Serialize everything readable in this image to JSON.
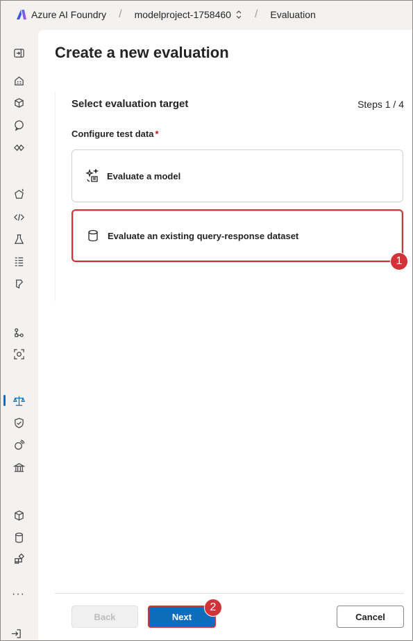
{
  "header": {
    "brand": "Azure AI Foundry",
    "project": "modelproject-1758460",
    "page": "Evaluation"
  },
  "rail": {
    "icons": [
      "expand-icon",
      "home-icon",
      "models-icon",
      "chat-icon",
      "overview-icon",
      "agents-icon",
      "code-icon",
      "playground-icon",
      "data-icon",
      "fine-tune-icon",
      "tracing-icon",
      "monitoring-icon",
      "evaluation-icon",
      "safety-icon",
      "guardrails-icon",
      "governance-icon",
      "model-catalog-icon",
      "datasets-icon",
      "apps-icon",
      "more-icon",
      "signout-icon"
    ],
    "more_label": "···",
    "active": "evaluation-icon"
  },
  "main": {
    "title": "Create a new evaluation",
    "section_title": "Select evaluation target",
    "steps": "Steps 1 / 4",
    "field_label": "Configure test data",
    "required_mark": "*",
    "options": [
      {
        "label": "Evaluate a model",
        "icon": "sparkle-list-icon"
      },
      {
        "label": "Evaluate an existing query-response dataset",
        "icon": "database-icon"
      }
    ]
  },
  "footer": {
    "back_label": "Back",
    "next_label": "Next",
    "cancel_label": "Cancel"
  },
  "callouts": [
    "1",
    "2"
  ],
  "colors": {
    "accent": "#0f6cbd",
    "highlight": "#d13438",
    "background": "#f3f2f1"
  }
}
